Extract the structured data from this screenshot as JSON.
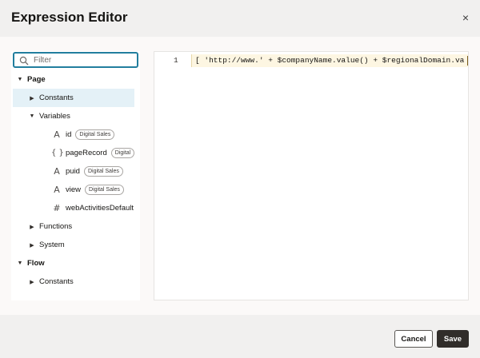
{
  "dialog": {
    "title": "Expression Editor",
    "close_glyph": "×"
  },
  "filter": {
    "placeholder": "Filter",
    "value": ""
  },
  "tree": {
    "page": {
      "label": "Page",
      "expanded": true
    },
    "constants": {
      "label": "Constants",
      "expanded": false,
      "selected": true
    },
    "variables": {
      "label": "Variables",
      "expanded": true
    },
    "vars": [
      {
        "icon": "string-type-icon",
        "glyph": "A",
        "label": "id",
        "badge": "Digital Sales"
      },
      {
        "icon": "object-type-icon",
        "glyph": "{ }",
        "label": "pageRecord",
        "badge": "Digital"
      },
      {
        "icon": "string-type-icon",
        "glyph": "A",
        "label": "puid",
        "badge": "Digital Sales"
      },
      {
        "icon": "string-type-icon",
        "glyph": "A",
        "label": "view",
        "badge": "Digital Sales"
      },
      {
        "icon": "number-type-icon",
        "glyph": "#",
        "label": "webActivitiesDefault",
        "badge": ""
      }
    ],
    "functions": {
      "label": "Functions",
      "expanded": false
    },
    "system": {
      "label": "System",
      "expanded": false
    },
    "flow": {
      "label": "Flow",
      "expanded": true
    },
    "flow_constants": {
      "label": "Constants",
      "expanded": false
    }
  },
  "editor": {
    "line_number": "1",
    "code": "[ 'http://www.' + $companyName.value() + $regionalDomain.va"
  },
  "footer": {
    "cancel_label": "Cancel",
    "save_label": "Save"
  },
  "colors": {
    "accent": "#227e9e",
    "selected_row": "#e4f1f7",
    "primary_button": "#312d2a",
    "code_highlight": "#fdf6e2"
  }
}
